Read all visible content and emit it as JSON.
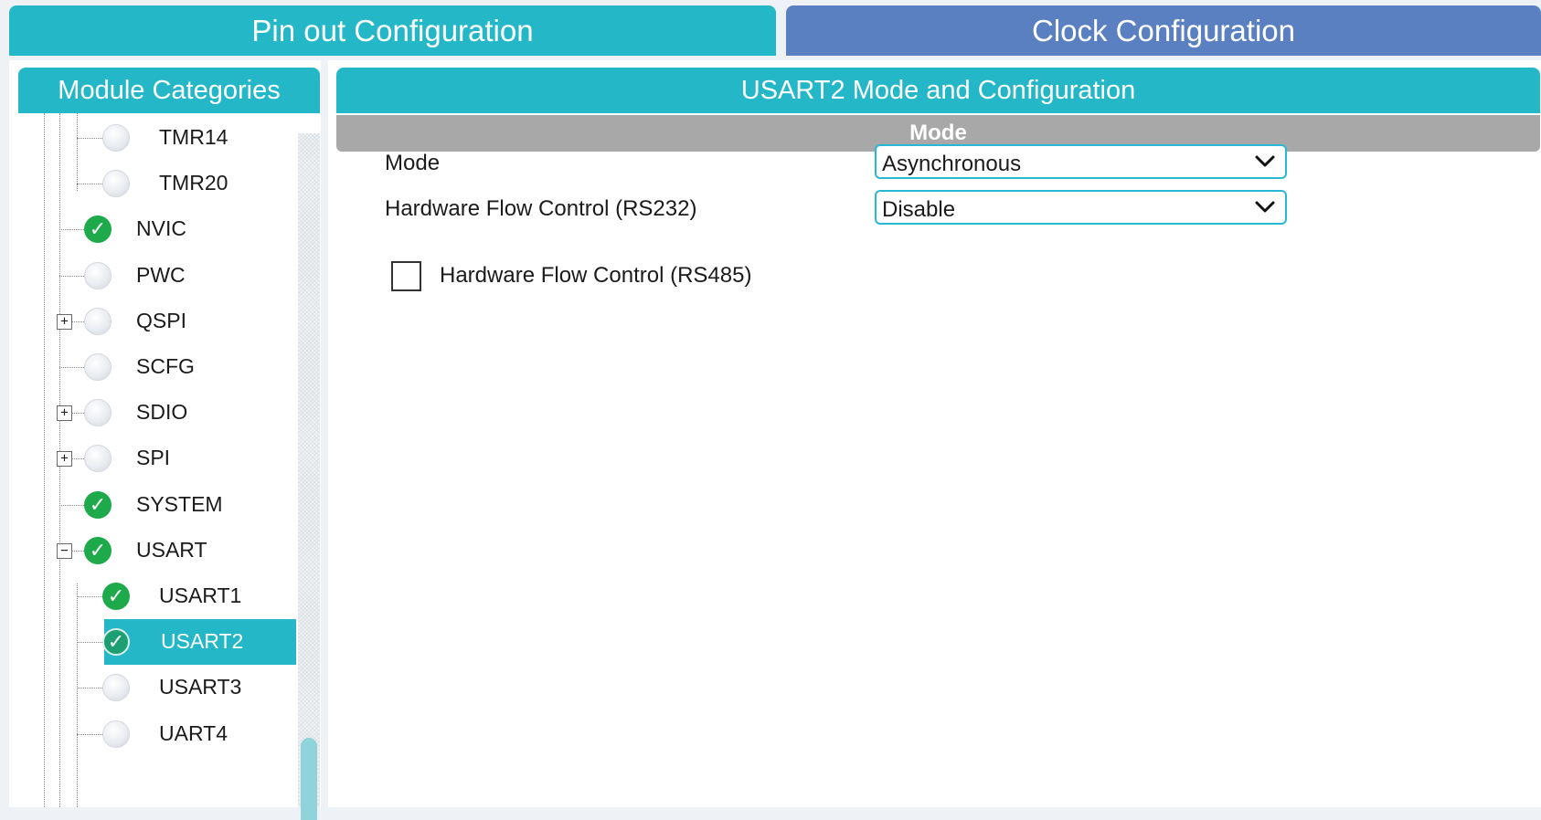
{
  "tabs": {
    "pinout": "Pin out  Configuration",
    "clock": "Clock Configuration"
  },
  "left_panel": {
    "title": "Module Categories",
    "tree": [
      {
        "label": "TMR14",
        "enabled": false,
        "child": true
      },
      {
        "label": "TMR20",
        "enabled": false,
        "child": true
      },
      {
        "label": "NVIC",
        "enabled": true,
        "child": false
      },
      {
        "label": "PWC",
        "enabled": false,
        "child": false
      },
      {
        "label": "QSPI",
        "enabled": false,
        "child": false,
        "expander": "+"
      },
      {
        "label": "SCFG",
        "enabled": false,
        "child": false
      },
      {
        "label": "SDIO",
        "enabled": false,
        "child": false,
        "expander": "+"
      },
      {
        "label": "SPI",
        "enabled": false,
        "child": false,
        "expander": "+"
      },
      {
        "label": "SYSTEM",
        "enabled": true,
        "child": false
      },
      {
        "label": "USART",
        "enabled": true,
        "child": false,
        "expander": "−"
      },
      {
        "label": "USART1",
        "enabled": true,
        "child": true
      },
      {
        "label": "USART2",
        "enabled": true,
        "child": true,
        "selected": true
      },
      {
        "label": "USART3",
        "enabled": false,
        "child": true
      },
      {
        "label": "UART4",
        "enabled": false,
        "child": true
      }
    ]
  },
  "right_panel": {
    "title": "USART2 Mode and Configuration",
    "section": "Mode",
    "fields": {
      "mode_label": "Mode",
      "mode_value": "Asynchronous",
      "flow_label": "Hardware Flow Control (RS232)",
      "flow_value": "Disable",
      "rs485_label": "Hardware Flow Control (RS485)",
      "rs485_checked": false
    }
  },
  "colors": {
    "accent": "#23b7c7",
    "clock_tab": "#5a80c2",
    "enabled": "#1ea94a",
    "section_bar": "#a8a8a8"
  }
}
